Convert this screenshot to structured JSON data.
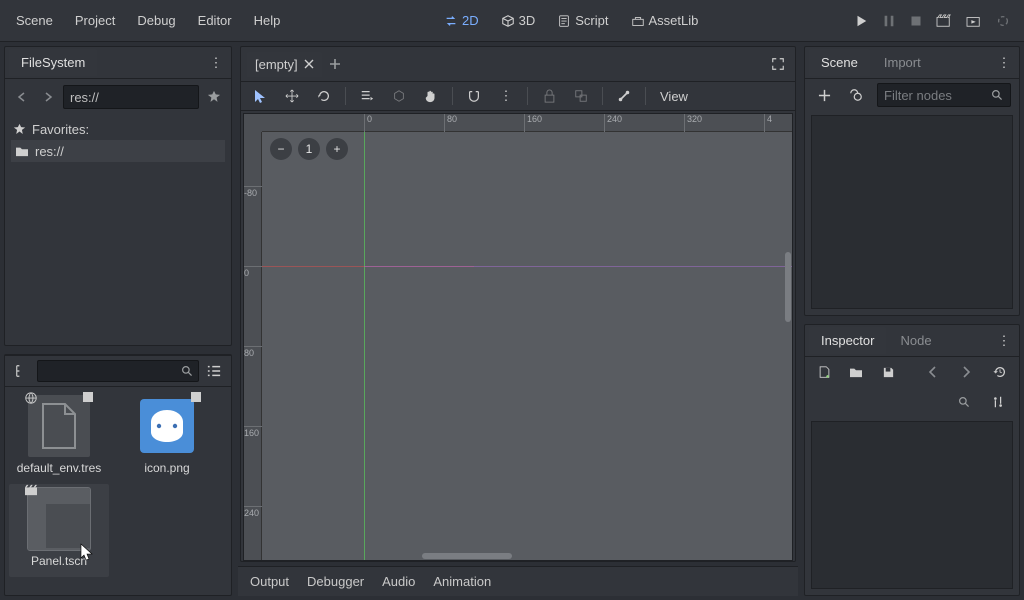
{
  "topmenu": {
    "scene": "Scene",
    "project": "Project",
    "debug": "Debug",
    "editor": "Editor",
    "help": "Help"
  },
  "workspaces": {
    "two_d": "2D",
    "three_d": "3D",
    "script": "Script",
    "assetlib": "AssetLib"
  },
  "left": {
    "filesystem_title": "FileSystem",
    "path": "res://",
    "favorites_label": "Favorites:",
    "res_label": "res://",
    "files": {
      "default_env": "default_env.tres",
      "icon_png": "icon.png",
      "panel_tscn": "Panel.tscn"
    }
  },
  "center": {
    "empty_tab": "[empty]",
    "view_label": "View",
    "ruler_h": {
      "t0": "0",
      "t80": "80",
      "t160": "160",
      "t240": "240",
      "t320": "320",
      "t400": "4"
    },
    "ruler_v": {
      "n80": "-80",
      "p0": "0",
      "p80": "80",
      "p160": "160",
      "p240": "240"
    },
    "zoom": {
      "minus": "−",
      "one": "1",
      "plus": "+"
    }
  },
  "bottom": {
    "output": "Output",
    "debugger": "Debugger",
    "audio": "Audio",
    "animation": "Animation"
  },
  "right": {
    "scene_tab": "Scene",
    "import_tab": "Import",
    "filter_placeholder": "Filter nodes",
    "inspector_tab": "Inspector",
    "node_tab": "Node"
  }
}
